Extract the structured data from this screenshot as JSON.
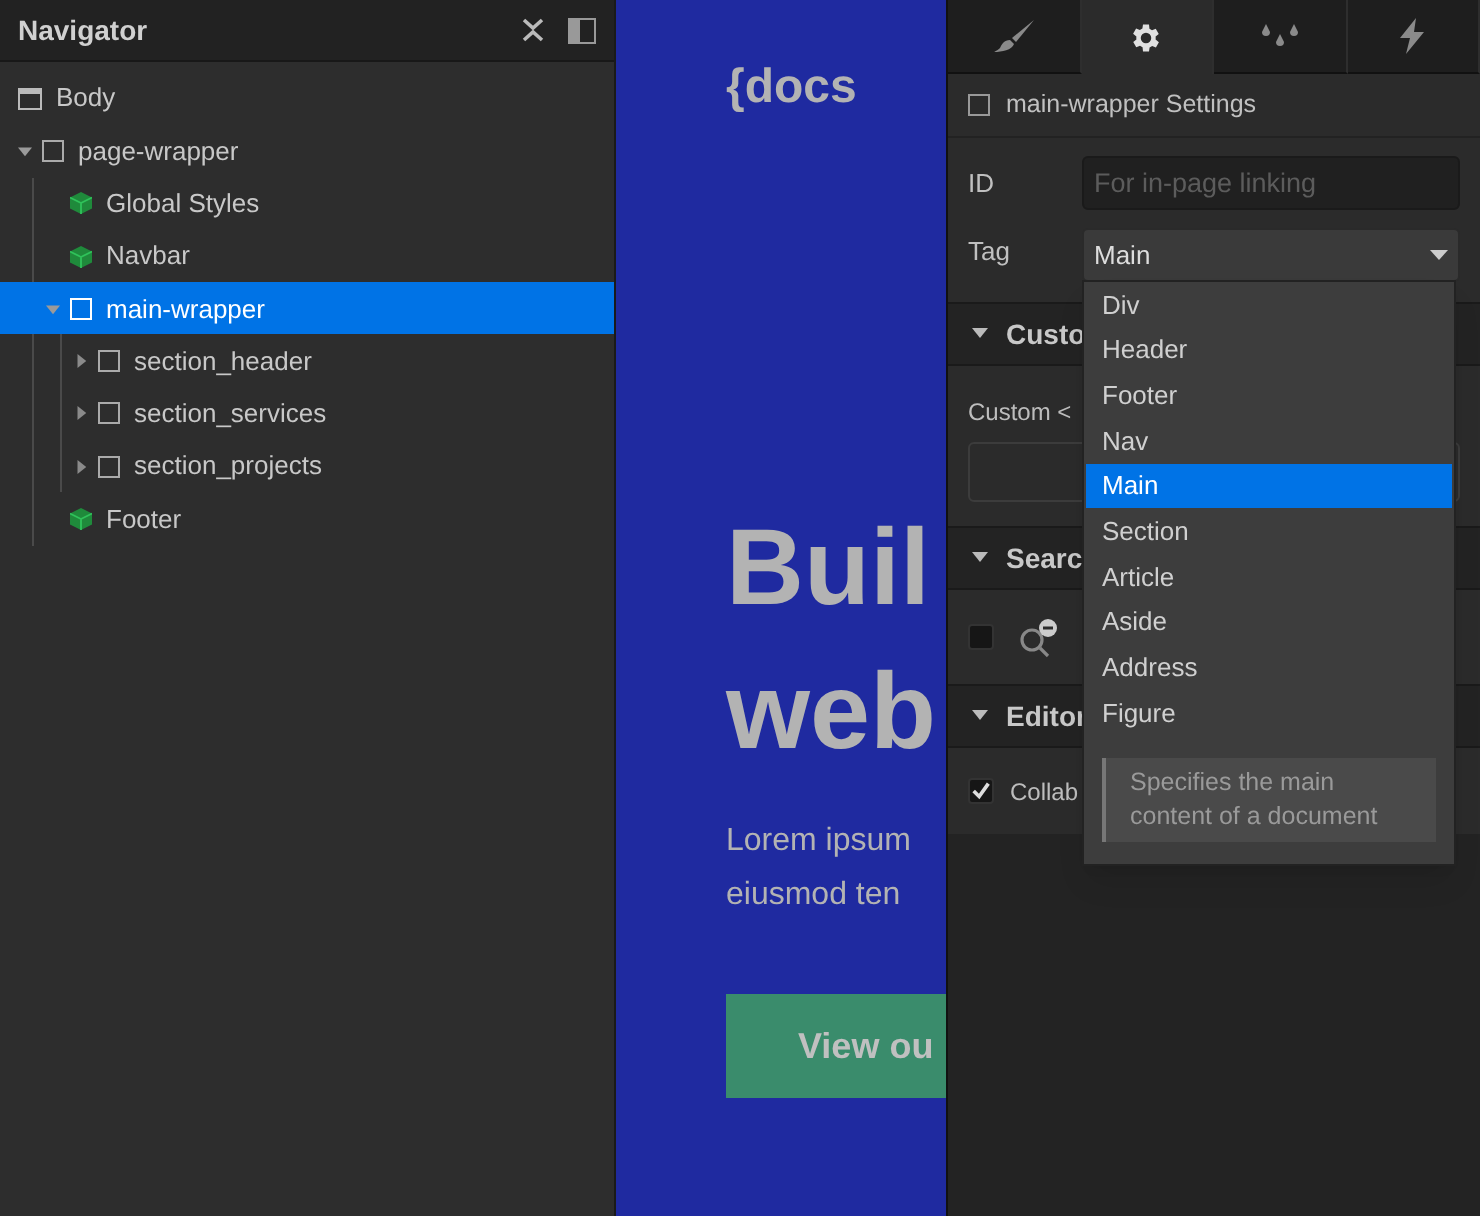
{
  "navigator": {
    "title": "Navigator",
    "tree": [
      {
        "label": "Body",
        "kind": "body",
        "selected": false
      },
      {
        "label": "page-wrapper",
        "kind": "element",
        "selected": false,
        "expanded": true,
        "children": [
          {
            "label": "Global Styles",
            "kind": "symbol",
            "selected": false
          },
          {
            "label": "Navbar",
            "kind": "symbol",
            "selected": false
          },
          {
            "label": "main-wrapper",
            "kind": "element",
            "selected": true,
            "expanded": true,
            "children": [
              {
                "label": "section_header",
                "kind": "element",
                "selected": false,
                "expanded": false
              },
              {
                "label": "section_services",
                "kind": "element",
                "selected": false,
                "expanded": false
              },
              {
                "label": "section_projects",
                "kind": "element",
                "selected": false,
                "expanded": false
              }
            ]
          },
          {
            "label": "Footer",
            "kind": "symbol",
            "selected": false
          }
        ]
      }
    ]
  },
  "canvas": {
    "logo": "{docs",
    "heading": [
      "Buil",
      "web"
    ],
    "paragraph": [
      "Lorem ipsum",
      "eiusmod ten"
    ],
    "button": "View ou"
  },
  "panel": {
    "tabs": [
      {
        "kind": "brush",
        "selected": false
      },
      {
        "kind": "gear",
        "selected": true
      },
      {
        "kind": "drops",
        "selected": false
      },
      {
        "kind": "bolt",
        "selected": false
      }
    ],
    "settings_title": "main-wrapper Settings",
    "id_label": "ID",
    "id_placeholder": "For in-page linking",
    "tag_label": "Tag",
    "tag_value": "Main",
    "sections": [
      {
        "title": "Custo",
        "expanded": true,
        "kind": "custom",
        "label": "Custom <"
      },
      {
        "title": "Searc",
        "expanded": true,
        "kind": "search",
        "checked": false
      },
      {
        "title": "Editor",
        "expanded": true,
        "kind": "editor",
        "checked": true,
        "label": "Collab"
      }
    ],
    "dropdown": {
      "options": [
        {
          "label": "Div",
          "selected": false
        },
        {
          "label": "Header",
          "selected": false
        },
        {
          "label": "Footer",
          "selected": false
        },
        {
          "label": "Nav",
          "selected": false
        },
        {
          "label": "Main",
          "selected": true
        },
        {
          "label": "Section",
          "selected": false
        },
        {
          "label": "Article",
          "selected": false
        },
        {
          "label": "Aside",
          "selected": false
        },
        {
          "label": "Address",
          "selected": false
        },
        {
          "label": "Figure",
          "selected": false
        }
      ],
      "hint": "Specifies the main content of a document"
    }
  }
}
